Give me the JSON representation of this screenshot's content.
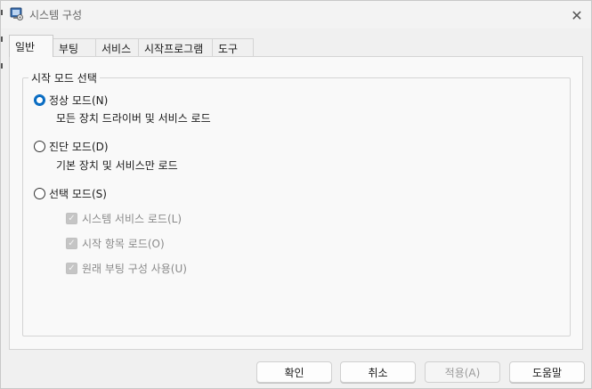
{
  "window": {
    "title": "시스템 구성",
    "close_glyph": "✕"
  },
  "tabs": [
    {
      "label": "일반",
      "active": true
    },
    {
      "label": "부팅",
      "active": false
    },
    {
      "label": "서비스",
      "active": false
    },
    {
      "label": "시작프로그램",
      "active": false
    },
    {
      "label": "도구",
      "active": false
    }
  ],
  "startup_selection": {
    "legend": "시작 모드 선택",
    "options": [
      {
        "label": "정상 모드(N)",
        "description": "모든 장치 드라이버 및 서비스 로드",
        "selected": true
      },
      {
        "label": "진단 모드(D)",
        "description": "기본 장치 및 서비스만 로드",
        "selected": false
      },
      {
        "label": "선택 모드(S)",
        "selected": false
      }
    ],
    "selective_checks": [
      {
        "label": "시스템 서비스 로드(L)",
        "checked": true,
        "enabled": false
      },
      {
        "label": "시작 항목 로드(O)",
        "checked": true,
        "enabled": false
      },
      {
        "label": "원래 부팅 구성 사용(U)",
        "checked": true,
        "enabled": false
      }
    ]
  },
  "buttons": {
    "ok": "확인",
    "cancel": "취소",
    "apply": "적용(A)",
    "help": "도움말"
  },
  "colors": {
    "accent": "#0067c0",
    "panel": "#f9f9f9",
    "window": "#f0f0f0",
    "disabled_text": "#8a8a8a"
  }
}
